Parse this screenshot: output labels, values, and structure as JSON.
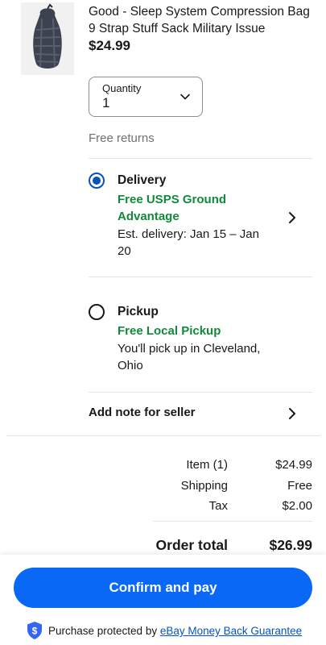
{
  "item": {
    "title": "Good - Sleep System Compression Bag 9 Strap Stuff Sack Military Issue",
    "price": "$24.99",
    "image_icon": "stuff-sack-photo"
  },
  "quantity": {
    "label": "Quantity",
    "value": "1"
  },
  "returns": "Free returns",
  "delivery": {
    "title": "Delivery",
    "service": "Free USPS Ground Advantage",
    "estimate": "Est. delivery: Jan 15 – Jan 20",
    "selected": true
  },
  "pickup": {
    "title": "Pickup",
    "service": "Free Local Pickup",
    "location": "You'll pick up in Cleveland, Ohio",
    "selected": false
  },
  "note_label": "Add note for seller",
  "summary": {
    "item_label": "Item (1)",
    "item_value": "$24.99",
    "shipping_label": "Shipping",
    "shipping_value": "Free",
    "tax_label": "Tax",
    "tax_value": "$2.00",
    "total_label": "Order total",
    "total_value": "$26.99"
  },
  "footer": {
    "button_label": "Confirm and pay",
    "protected_prefix": "Purchase protected by ",
    "guarantee_link": "eBay Money Back Guarantee"
  },
  "colors": {
    "accent_blue": "#0968f6",
    "link_blue": "#0654ba",
    "free_green": "#108a3a"
  }
}
